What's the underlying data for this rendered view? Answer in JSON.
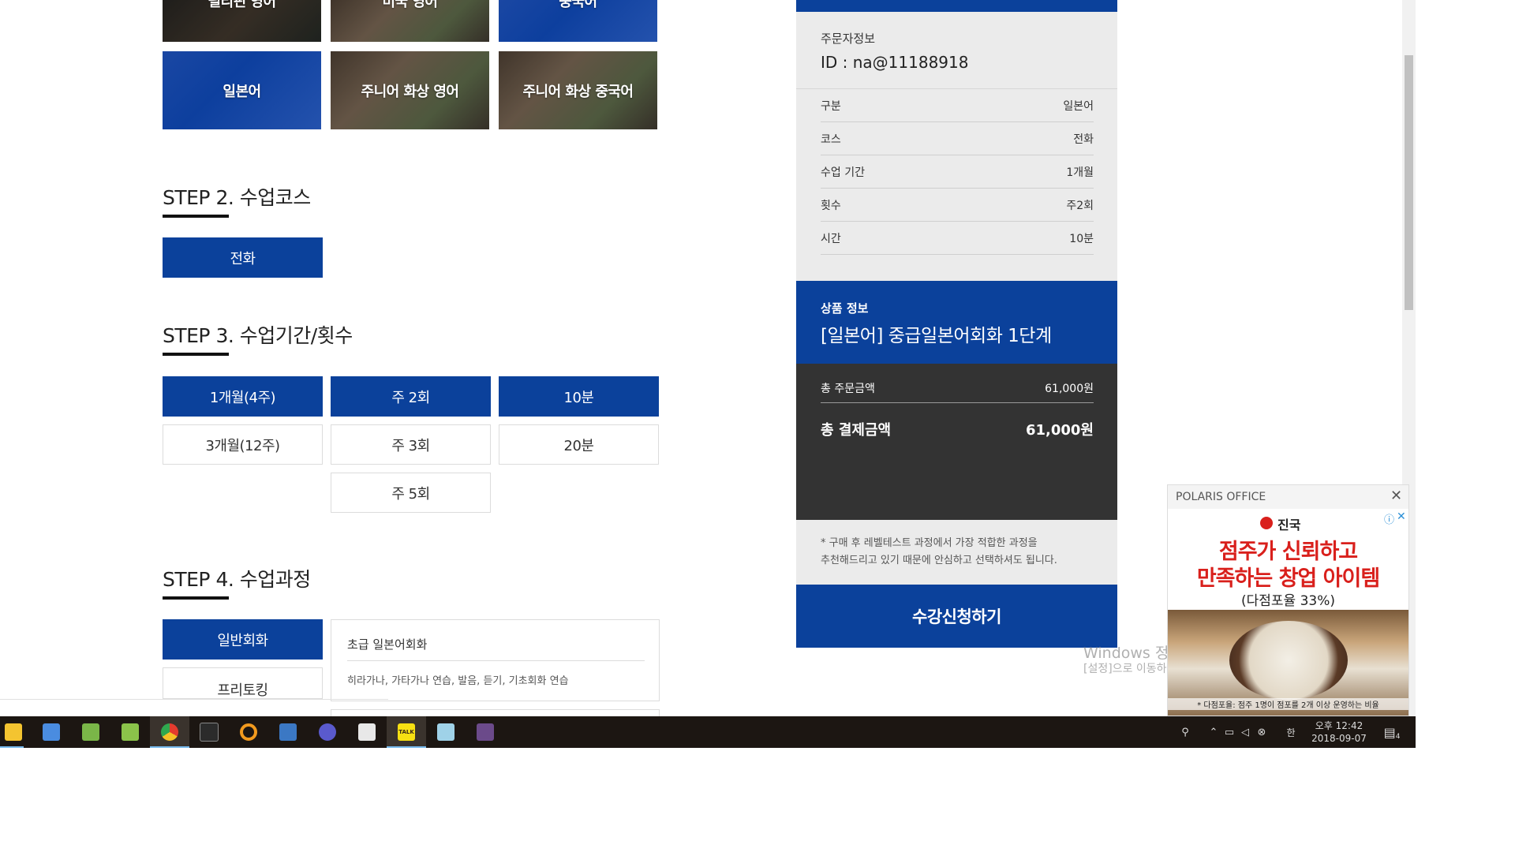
{
  "tiles": {
    "row1": [
      "필리핀 영어",
      "미국 영어",
      "중국어"
    ],
    "row2": [
      "일본어",
      "주니어 화상 영어",
      "주니어 화상 중국어"
    ]
  },
  "step2": {
    "title_num": "STEP 2.",
    "title_text": "수업코스",
    "options": [
      "전화"
    ],
    "selected": "전화"
  },
  "step3": {
    "title_num": "STEP 3.",
    "title_text": "수업기간/횟수",
    "period": [
      "1개월(4주)",
      "3개월(12주)"
    ],
    "count": [
      "주 2회",
      "주 3회",
      "주 5회"
    ],
    "time": [
      "10분",
      "20분"
    ],
    "selected": [
      "1개월(4주)",
      "주 2회",
      "10분"
    ]
  },
  "step4": {
    "title_num": "STEP 4.",
    "title_text": "수업과정",
    "categories": [
      "일반회화",
      "프리토킹"
    ],
    "selected": "일반회화",
    "course": {
      "title": "초급 일본어회화",
      "desc": "히라가나, 가타가나 연습, 발음, 듣기, 기초회화 연습"
    }
  },
  "order": {
    "user_label": "주문자정보",
    "user_id": "ID : na@11188918",
    "details": [
      {
        "label": "구분",
        "value": "일본어"
      },
      {
        "label": "코스",
        "value": "전화"
      },
      {
        "label": "수업 기간",
        "value": "1개월"
      },
      {
        "label": "횟수",
        "value": "주2회"
      },
      {
        "label": "시간",
        "value": "10분"
      }
    ],
    "product_label": "상품 정보",
    "product_name": "[일본어] 중급일본어회화 1단계",
    "total_order_label": "총 주문금액",
    "total_order_value": "61,000원",
    "total_pay_label": "총 결제금액",
    "total_pay_value": "61,000원",
    "note_line1": "* 구매 후 레벨테스트 과정에서 가장 적합한 과정을",
    "note_line2": "추천해드리고 있기 때문에 안심하고 선택하셔도 됩니다.",
    "submit": "수강신청하기"
  },
  "ad": {
    "header": "POLARIS OFFICE",
    "brand": "진국",
    "headline1": "점주가 신뢰하고",
    "headline2": "만족하는 창업 아이템",
    "sub": "(다점포율 33%)",
    "footnote": "* 다점포율: 점주 1명이 점포를 2개 이상 운영하는 비율"
  },
  "watermark": {
    "line1": "Windows 정품 인증",
    "line2": "[설정]으로 이동하여 Windows를 정품 인증합니다."
  },
  "taskbar": {
    "icons": [
      "folder-icon",
      "store-icon",
      "server-icon",
      "sheet-icon",
      "chrome-icon",
      "terminal-icon",
      "search-app-icon",
      "app-icon",
      "ie-icon",
      "mail-icon",
      "kakaotalk-icon",
      "notepad-icon",
      "game-icon"
    ],
    "kakao_label": "TALK",
    "time": "오후 12:42",
    "date": "2018-09-07",
    "ime": "한",
    "notification_count": "4"
  },
  "colors": {
    "primary": "#0b419b",
    "dark": "#333333",
    "panel_bg": "#ebebeb",
    "ad_red": "#d9201c"
  }
}
